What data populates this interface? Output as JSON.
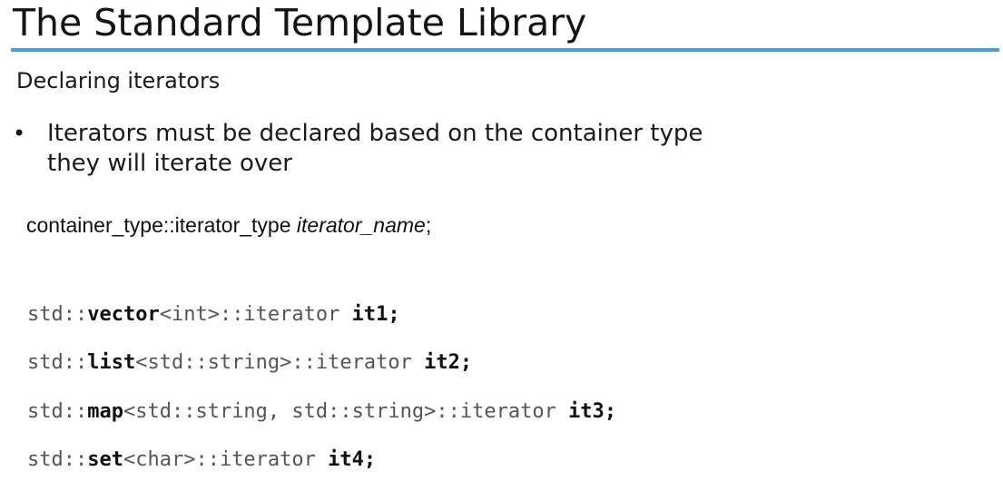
{
  "slide": {
    "title": "The Standard Template Library",
    "subtitle": "Declaring iterators",
    "bullet_marker": "•",
    "bullet_line1": "Iterators must be declared based on the container type",
    "bullet_line2": "they will iterate over",
    "syntax": {
      "prefix": "container_type::iterator_type ",
      "italic": "iterator_name",
      "suffix": ";"
    },
    "code_lines": [
      {
        "p1": "std::",
        "kw": "vector",
        "p2": "<int>::iterator ",
        "id": "it1",
        "end": ";"
      },
      {
        "p1": "std::",
        "kw": "list",
        "p2": "<std::string>::iterator ",
        "id": "it2",
        "end": ";"
      },
      {
        "p1": "std::",
        "kw": "map",
        "p2": "<std::string, std::string>::iterator ",
        "id": "it3",
        "end": ";"
      },
      {
        "p1": "std::",
        "kw": "set",
        "p2": "<char>::iterator ",
        "id": "it4",
        "end": ";"
      }
    ],
    "colors": {
      "accent_rule": "#4a9ede",
      "code_normal": "#555555",
      "code_bold": "#111111"
    }
  }
}
